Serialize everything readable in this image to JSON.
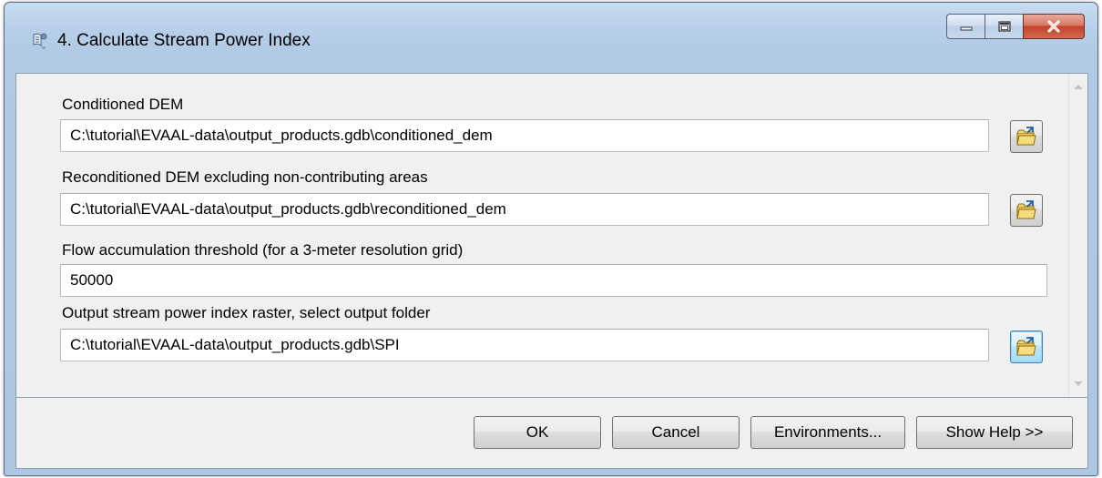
{
  "window": {
    "title": "4. Calculate Stream Power Index"
  },
  "fields": [
    {
      "label": "Conditioned DEM",
      "value": "C:\\tutorial\\EVAAL-data\\output_products.gdb\\conditioned_dem"
    },
    {
      "label": "Reconditioned DEM excluding non-contributing areas",
      "value": "C:\\tutorial\\EVAAL-data\\output_products.gdb\\reconditioned_dem"
    },
    {
      "label": "Flow accumulation threshold (for a 3-meter resolution grid)",
      "value": "50000"
    },
    {
      "label": "Output stream power index raster, select output folder",
      "value": "C:\\tutorial\\EVAAL-data\\output_products.gdb\\SPI"
    }
  ],
  "buttons": {
    "ok": "OK",
    "cancel": "Cancel",
    "environments": "Environments...",
    "show_help": "Show Help >>"
  },
  "icons": {
    "window": "toolbox-script-icon",
    "browse": "folder-browse-icon"
  }
}
